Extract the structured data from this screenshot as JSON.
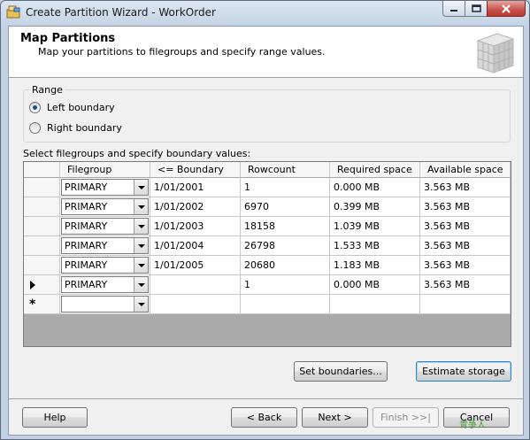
{
  "window": {
    "title": "Create Partition Wizard - WorkOrder"
  },
  "header": {
    "title": "Map Partitions",
    "subtitle": "Map your partitions to filegroups and specify range values."
  },
  "range": {
    "legend": "Range",
    "options": [
      {
        "label": "Left boundary",
        "checked": true
      },
      {
        "label": "Right boundary",
        "checked": false
      }
    ]
  },
  "grid": {
    "caption": "Select filegroups and specify boundary values:",
    "columns": [
      "Filegroup",
      "<= Boundary",
      "Rowcount",
      "Required space",
      "Available space"
    ],
    "rows": [
      {
        "marker": "",
        "filegroup": "PRIMARY",
        "boundary": "1/01/2001",
        "rowcount": "1",
        "required": "0.000 MB",
        "available": "3.563 MB"
      },
      {
        "marker": "",
        "filegroup": "PRIMARY",
        "boundary": "1/01/2002",
        "rowcount": "6970",
        "required": "0.399 MB",
        "available": "3.563 MB"
      },
      {
        "marker": "",
        "filegroup": "PRIMARY",
        "boundary": "1/01/2003",
        "rowcount": "18158",
        "required": "1.039 MB",
        "available": "3.563 MB"
      },
      {
        "marker": "",
        "filegroup": "PRIMARY",
        "boundary": "1/01/2004",
        "rowcount": "26798",
        "required": "1.533 MB",
        "available": "3.563 MB"
      },
      {
        "marker": "",
        "filegroup": "PRIMARY",
        "boundary": "1/01/2005",
        "rowcount": "20680",
        "required": "1.183 MB",
        "available": "3.563 MB"
      },
      {
        "marker": "current",
        "filegroup": "PRIMARY",
        "boundary": "",
        "rowcount": "1",
        "required": "0.000 MB",
        "available": "3.563 MB"
      },
      {
        "marker": "new",
        "filegroup": "",
        "boundary": "",
        "rowcount": "",
        "required": "",
        "available": ""
      }
    ],
    "new_row_glyph": "*"
  },
  "buttons": {
    "set_boundaries": "Set boundaries...",
    "estimate_storage": "Estimate storage",
    "help": "Help",
    "back": "< Back",
    "next": "Next >",
    "finish": "Finish >>|",
    "cancel": "Cancel"
  },
  "watermark": "青争人"
}
